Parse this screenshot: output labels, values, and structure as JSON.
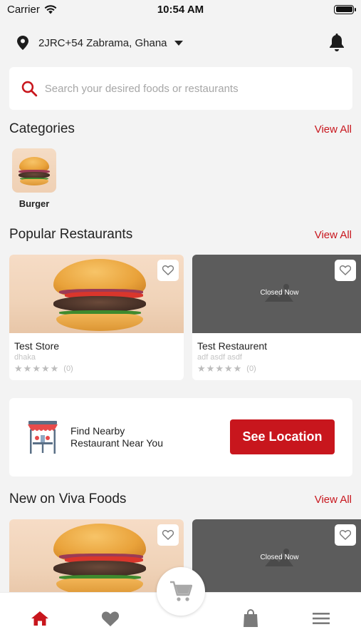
{
  "status_bar": {
    "carrier": "Carrier",
    "time": "10:54 AM"
  },
  "header": {
    "location": "2JRC+54 Zabrama, Ghana",
    "location_icon": "map-pin-icon",
    "notification_icon": "bell-icon"
  },
  "search": {
    "placeholder": "Search your desired foods or restaurants",
    "icon": "search-icon"
  },
  "categories": {
    "title": "Categories",
    "view_all": "View All",
    "items": [
      {
        "label": "Burger"
      }
    ]
  },
  "popular": {
    "title": "Popular Restaurants",
    "view_all": "View All",
    "items": [
      {
        "name": "Test Store",
        "address": "dhaka",
        "rating_count": "(0)",
        "closed": false
      },
      {
        "name": "Test Restaurent",
        "address": "adf asdf asdf",
        "rating_count": "(0)",
        "closed": true,
        "closed_label": "Closed Now"
      }
    ]
  },
  "nearby": {
    "line1": "Find Nearby",
    "line2": "Restaurant Near You",
    "button": "See Location"
  },
  "new_on": {
    "title": "New on Viva Foods",
    "view_all": "View All",
    "items": [
      {
        "closed": false
      },
      {
        "closed": true,
        "closed_label": "Closed Now"
      }
    ]
  },
  "bottom_nav": {
    "items": [
      "home-icon",
      "heart-icon",
      "cart-icon",
      "bag-icon",
      "menu-icon"
    ],
    "active": "home-icon"
  },
  "colors": {
    "accent": "#c8161d",
    "background": "#f3f3f3",
    "placeholder_gray": "#5c5c5c"
  }
}
